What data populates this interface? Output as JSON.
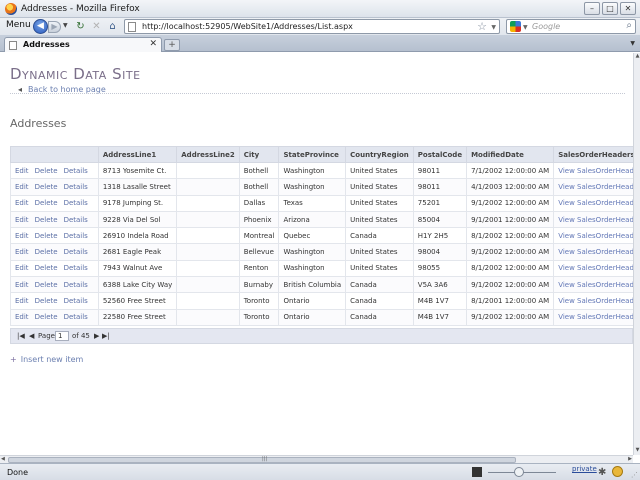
{
  "window": {
    "title": "Addresses - Mozilla Firefox",
    "controls": [
      "–",
      "□",
      "✕"
    ]
  },
  "toolbar": {
    "menu_label": "Menu",
    "url": "http://localhost:52905/WebSite1/Addresses/List.aspx",
    "search_placeholder": "Google"
  },
  "tabs": [
    {
      "label": "Addresses",
      "active": true
    }
  ],
  "page": {
    "site_title": "Dynamic Data Site",
    "back_link": "Back to home page",
    "heading": "Addresses",
    "insert_link": "Insert new item"
  },
  "grid": {
    "columns": [
      "",
      "AddressLine1",
      "AddressLine2",
      "City",
      "StateProvince",
      "CountryRegion",
      "PostalCode",
      "ModifiedDate",
      "SalesOrderHeaders",
      "SalesOrderHeaders"
    ],
    "actions": [
      "Edit",
      "Delete",
      "Details"
    ],
    "link_text": "View SalesOrderHeaders",
    "rows": [
      [
        "8713 Yosemite Ct.",
        "",
        "Bothell",
        "Washington",
        "United States",
        "98011",
        "7/1/2002 12:00:00 AM"
      ],
      [
        "1318 Lasalle Street",
        "",
        "Bothell",
        "Washington",
        "United States",
        "98011",
        "4/1/2003 12:00:00 AM"
      ],
      [
        "9178 Jumping St.",
        "",
        "Dallas",
        "Texas",
        "United States",
        "75201",
        "9/1/2002 12:00:00 AM"
      ],
      [
        "9228 Via Del Sol",
        "",
        "Phoenix",
        "Arizona",
        "United States",
        "85004",
        "9/1/2001 12:00:00 AM"
      ],
      [
        "26910 Indela Road",
        "",
        "Montreal",
        "Quebec",
        "Canada",
        "H1Y 2H5",
        "8/1/2002 12:00:00 AM"
      ],
      [
        "2681 Eagle Peak",
        "",
        "Bellevue",
        "Washington",
        "United States",
        "98004",
        "9/1/2002 12:00:00 AM"
      ],
      [
        "7943 Walnut Ave",
        "",
        "Renton",
        "Washington",
        "United States",
        "98055",
        "8/1/2002 12:00:00 AM"
      ],
      [
        "6388 Lake City Way",
        "",
        "Burnaby",
        "British Columbia",
        "Canada",
        "V5A 3A6",
        "9/1/2002 12:00:00 AM"
      ],
      [
        "52560 Free Street",
        "",
        "Toronto",
        "Ontario",
        "Canada",
        "M4B 1V7",
        "8/1/2001 12:00:00 AM"
      ],
      [
        "22580 Free Street",
        "",
        "Toronto",
        "Ontario",
        "Canada",
        "M4B 1V7",
        "9/1/2002 12:00:00 AM"
      ]
    ]
  },
  "pager": {
    "page_label": "Page",
    "current_page": "1",
    "of_label": "of 45"
  },
  "status": {
    "text": "Done",
    "private_label": "private"
  }
}
